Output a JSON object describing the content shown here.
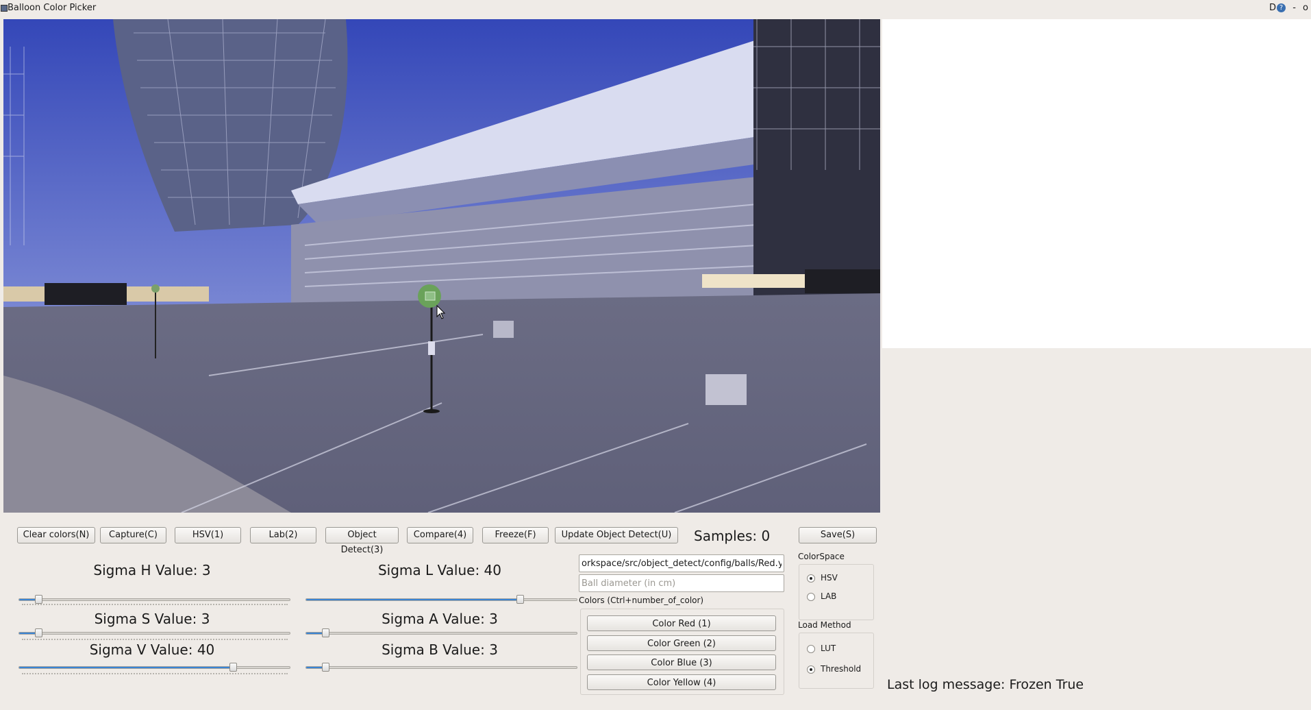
{
  "window": {
    "title": "Balloon Color Picker",
    "controls": [
      "D",
      "?",
      "-",
      "o"
    ]
  },
  "toolbar": {
    "buttons": [
      {
        "label": "Clear colors(N)"
      },
      {
        "label": "Capture(C)"
      },
      {
        "label": "HSV(1)"
      },
      {
        "label": "Lab(2)"
      },
      {
        "label": "Object Detect(3)"
      },
      {
        "label": "Compare(4)"
      },
      {
        "label": "Freeze(F)"
      },
      {
        "label": "Update Object Detect(U)"
      }
    ],
    "samples": "Samples: 0",
    "save": "Save(S)"
  },
  "sliders": {
    "sigma_h": {
      "label": "Sigma H Value: 3",
      "fraction": 0.07
    },
    "sigma_s": {
      "label": "Sigma S Value: 3",
      "fraction": 0.07
    },
    "sigma_v": {
      "label": "Sigma V Value: 40",
      "fraction": 0.79
    },
    "sigma_l": {
      "label": "Sigma L Value: 40",
      "fraction": 0.79
    },
    "sigma_a": {
      "label": "Sigma A Value: 3",
      "fraction": 0.07
    },
    "sigma_b": {
      "label": "Sigma B Value: 3",
      "fraction": 0.07
    }
  },
  "config": {
    "path_value": "orkspace/src/object_detect/config/balls/Red.yaml",
    "diameter_placeholder": "Ball diameter (in cm)",
    "colors_label": "Colors (Ctrl+number_of_color)",
    "colors": [
      "Color Red (1)",
      "Color Green (2)",
      "Color Blue (3)",
      "Color Yellow (4)"
    ]
  },
  "colorspace": {
    "label": "ColorSpace",
    "options": [
      {
        "label": "HSV",
        "checked": true
      },
      {
        "label": "LAB",
        "checked": false
      }
    ]
  },
  "load_method": {
    "label": "Load Method",
    "options": [
      {
        "label": "LUT",
        "checked": false
      },
      {
        "label": "Threshold",
        "checked": true
      }
    ]
  },
  "log": {
    "text": "Last log message: Frozen True"
  },
  "colors": {
    "slider_fill": "#3a84d3",
    "background": "#efebe7"
  }
}
